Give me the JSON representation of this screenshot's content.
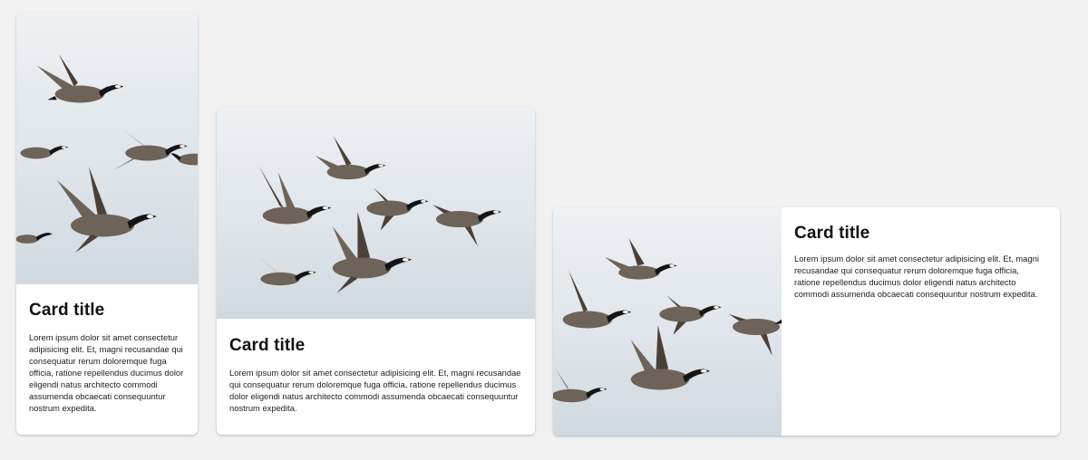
{
  "cards": [
    {
      "title": "Card title",
      "body": "Lorem ipsum dolor sit amet consectetur adipisicing elit. Et, magni recusandae qui consequatur rerum doloremque fuga officia, ratione repellendus ducimus dolor eligendi natus architecto commodi assumenda obcaecati consequuntur nostrum expedita.",
      "image": "flying-geese-photo"
    },
    {
      "title": "Card title",
      "body": "Lorem ipsum dolor sit amet consectetur adipisicing elit. Et, magni recusandae qui consequatur rerum doloremque fuga officia, ratione repellendus ducimus dolor eligendi natus architecto commodi assumenda obcaecati consequuntur nostrum expedita.",
      "image": "flying-geese-photo"
    },
    {
      "title": "Card title",
      "body": "Lorem ipsum dolor sit amet consectetur adipisicing elit. Et, magni recusandae qui consequatur rerum doloremque fuga officia, ratione repellendus ducimus dolor eligendi natus architecto commodi assumenda obcaecati consequuntur nostrum expedita.",
      "image": "flying-geese-photo"
    }
  ],
  "colors": {
    "page_background": "#f2f2f2",
    "card_background": "#ffffff",
    "title_text": "#111111",
    "body_text": "#222222",
    "sky": "#dfe5ea",
    "goose_body": "#6e6358",
    "goose_wing": "#4a4038",
    "goose_neck": "#151515",
    "goose_cheek": "#f4f1ea"
  }
}
